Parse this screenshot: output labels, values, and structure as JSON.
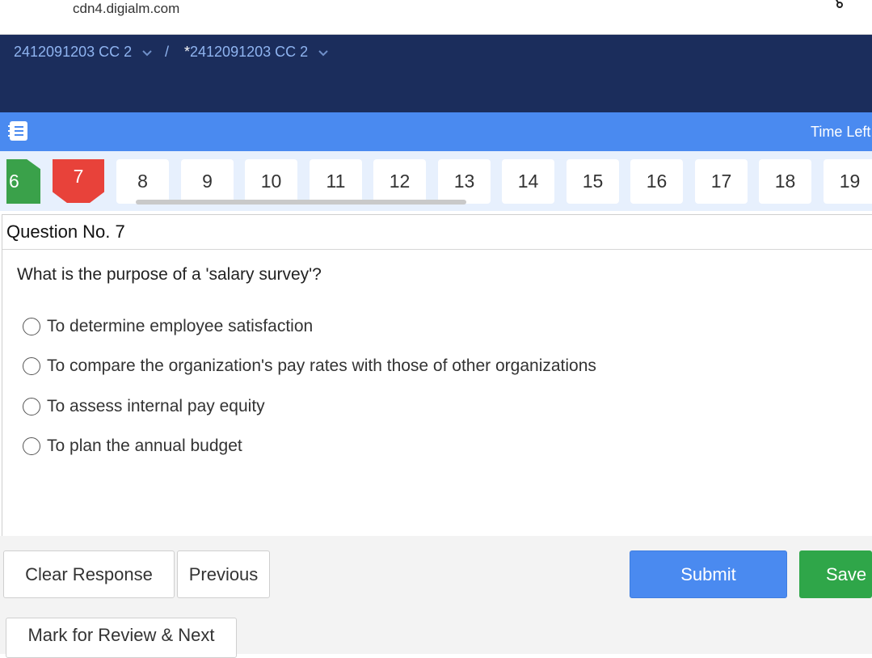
{
  "browser": {
    "url": "cdn4.digialm.com"
  },
  "header": {
    "crumb1": "2412091203 CC 2",
    "separator": "/",
    "crumb2_star": "*",
    "crumb2": "2412091203 CC 2"
  },
  "toolbar": {
    "time_left_label": "Time Left"
  },
  "question_numbers": {
    "answered": "6",
    "current": "7",
    "others": [
      "8",
      "9",
      "10",
      "11",
      "12",
      "13",
      "14",
      "15",
      "16",
      "17",
      "18",
      "19"
    ]
  },
  "question": {
    "title": "Question No. 7",
    "text": "What is the purpose of a 'salary survey'?",
    "options": [
      "To determine employee satisfaction",
      "To compare the organization's pay rates with those of other organizations",
      "To assess internal pay equity",
      "To plan the annual budget"
    ]
  },
  "footer": {
    "clear_label": "Clear Response",
    "previous_label": "Previous",
    "submit_label": "Submit",
    "save_label": "Save",
    "mark_review_label": "Mark for Review & Next"
  },
  "colors": {
    "header_navy": "#1b2d5c",
    "toolbar_blue": "#4a8af0",
    "answered_green": "#3aa14a",
    "current_red": "#e8423a",
    "save_green": "#2fa649"
  }
}
